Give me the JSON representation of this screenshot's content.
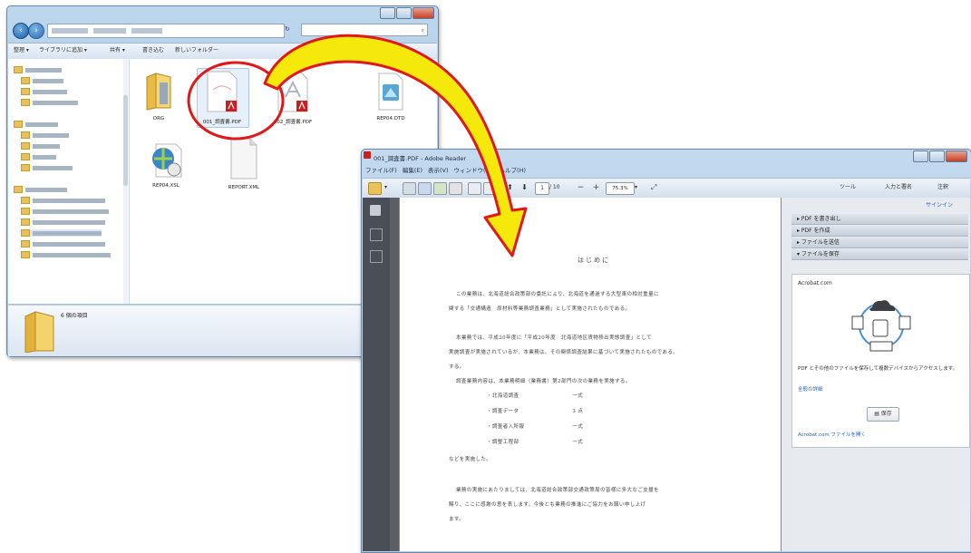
{
  "explorer": {
    "toolbar_items": [
      "整理 ▾",
      "ライブラリに追加 ▾",
      "共有 ▾",
      "書き込む",
      "新しいフォルダー"
    ],
    "files": [
      {
        "name": "ORG",
        "icon": "folder-icon"
      },
      {
        "name": "001_調査書.PDF",
        "icon": "pdf-file-icon"
      },
      {
        "name": "002_調査書.PDF",
        "icon": "pdf-file-icon"
      },
      {
        "name": "REP04.DTD",
        "icon": "dtd-file-icon"
      },
      {
        "name": "REP04.XSL",
        "icon": "xsl-file-icon"
      },
      {
        "name": "REPORT.XML",
        "icon": "xml-file-icon"
      }
    ],
    "status": "6 個の項目"
  },
  "reader": {
    "title": "001_調査書.PDF - Adobe Reader",
    "menu": [
      "ファイル(F)",
      "編集(E)",
      "表示(V)",
      "ウィンドウ(W)",
      "ヘルプ(H)"
    ],
    "page_number": "1",
    "page_total": "/ 10",
    "zoom": "75.3%",
    "tools": [
      "ツール",
      "入力と署名",
      "注釈"
    ],
    "signin": "サインイン",
    "panel_sections": [
      "PDF を書き出し",
      "PDF を作成",
      "ファイルを送信",
      "ファイルを保存"
    ],
    "acrobat_label": "Acrobat.com",
    "save_desc": "PDF とその他のファイルを保存して複数デバイスからアクセスします。",
    "learn_more": "全般の詳細",
    "save_button": "保存",
    "open_acrobat": "Acrobat.com ファイルを開く",
    "doc": {
      "heading": "はじめに",
      "lines": [
        "この業務は、北海道総合政策部の委託により、北海道を通過する大型車の相対重量に",
        "関する「交通構造　原材料等業務調査業務」として実施されたものである。",
        "",
        "本業務では、平成20年度に「平成20年度　北海道地区貨物移出実態調査」として",
        "実施調査が実施されているが、本業務は、その関係調査結果に基づいて実施されたものである。",
        "",
        "調査業務内容は、本業務明細（業務書）第2部門の次の業務を実施する。",
        "・北海道調査　　　　　　　　　　一式",
        "・調査データ　　　　　　　　　　3 点",
        "・調査者入所報　　　　　　　　　一式",
        "・調整工程部　　　　　　　　　　一式",
        "などを実施した。",
        "",
        "業務の実施にあたりましては、北海道総合政策部交通政策局の皆様に多大なご支援を",
        "賜り、ここに感謝の意を表します。今後とも業務の推進にご協力をお願い申し上げ",
        "ます。"
      ]
    }
  },
  "colors": {
    "callout_red": "#e01818",
    "arrow_yellow": "#f5e90b",
    "arrow_outline": "#e01818"
  }
}
